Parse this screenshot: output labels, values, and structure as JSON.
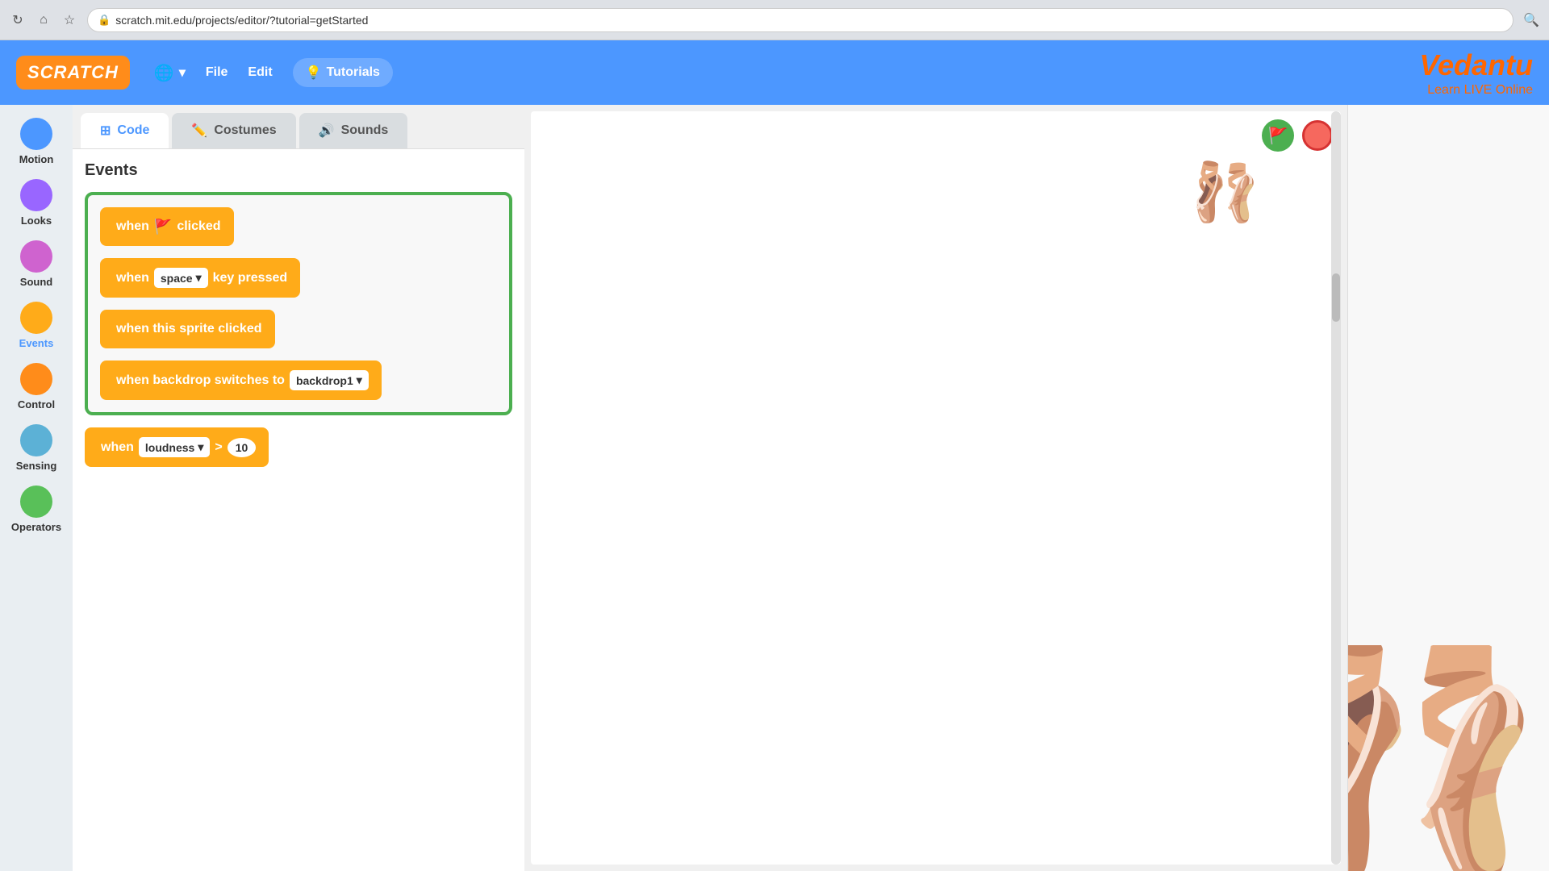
{
  "browser": {
    "url": "scratch.mit.edu/projects/editor/?tutorial=getStarted",
    "reload_icon": "↻",
    "home_icon": "⌂",
    "bookmark_icon": "☆",
    "lock_icon": "🔒",
    "search_icon": "🔍"
  },
  "header": {
    "logo": "SCRATCH",
    "globe_icon": "🌐",
    "file_label": "File",
    "edit_label": "Edit",
    "bulb_icon": "💡",
    "tutorials_label": "Tutorials",
    "vedantu_name": "Vedantu",
    "vedantu_tagline": "Learn LIVE Online"
  },
  "tabs": {
    "code_label": "Code",
    "costumes_label": "Costumes",
    "sounds_label": "Sounds"
  },
  "categories": [
    {
      "id": "motion",
      "label": "Motion",
      "color": "#4c97ff"
    },
    {
      "id": "looks",
      "label": "Looks",
      "color": "#9966ff"
    },
    {
      "id": "sound",
      "label": "Sound",
      "color": "#cf63cf"
    },
    {
      "id": "events",
      "label": "Events",
      "color": "#ffab19",
      "active": true
    },
    {
      "id": "control",
      "label": "Control",
      "color": "#ff8c1a"
    },
    {
      "id": "sensing",
      "label": "Sensing",
      "color": "#5cb1d6"
    },
    {
      "id": "operators",
      "label": "Operators",
      "color": "#59c059"
    }
  ],
  "blocks_panel": {
    "title": "Events",
    "blocks": [
      {
        "id": "when-flag-clicked",
        "text_before": "when",
        "icon": "🚩",
        "text_after": "clicked",
        "type": "flag"
      },
      {
        "id": "when-key-pressed",
        "text_before": "when",
        "dropdown": "space",
        "text_after": "key pressed",
        "type": "key"
      },
      {
        "id": "when-sprite-clicked",
        "text": "when this sprite clicked",
        "type": "simple"
      },
      {
        "id": "when-backdrop-switches",
        "text_before": "when backdrop switches to",
        "dropdown": "backdrop1",
        "type": "backdrop"
      }
    ],
    "when_loudness_block": {
      "text_before": "when",
      "dropdown": "loudness",
      "operator": ">",
      "value": "10"
    }
  },
  "stage": {
    "green_flag_label": "▶",
    "stop_label": "⬛"
  }
}
